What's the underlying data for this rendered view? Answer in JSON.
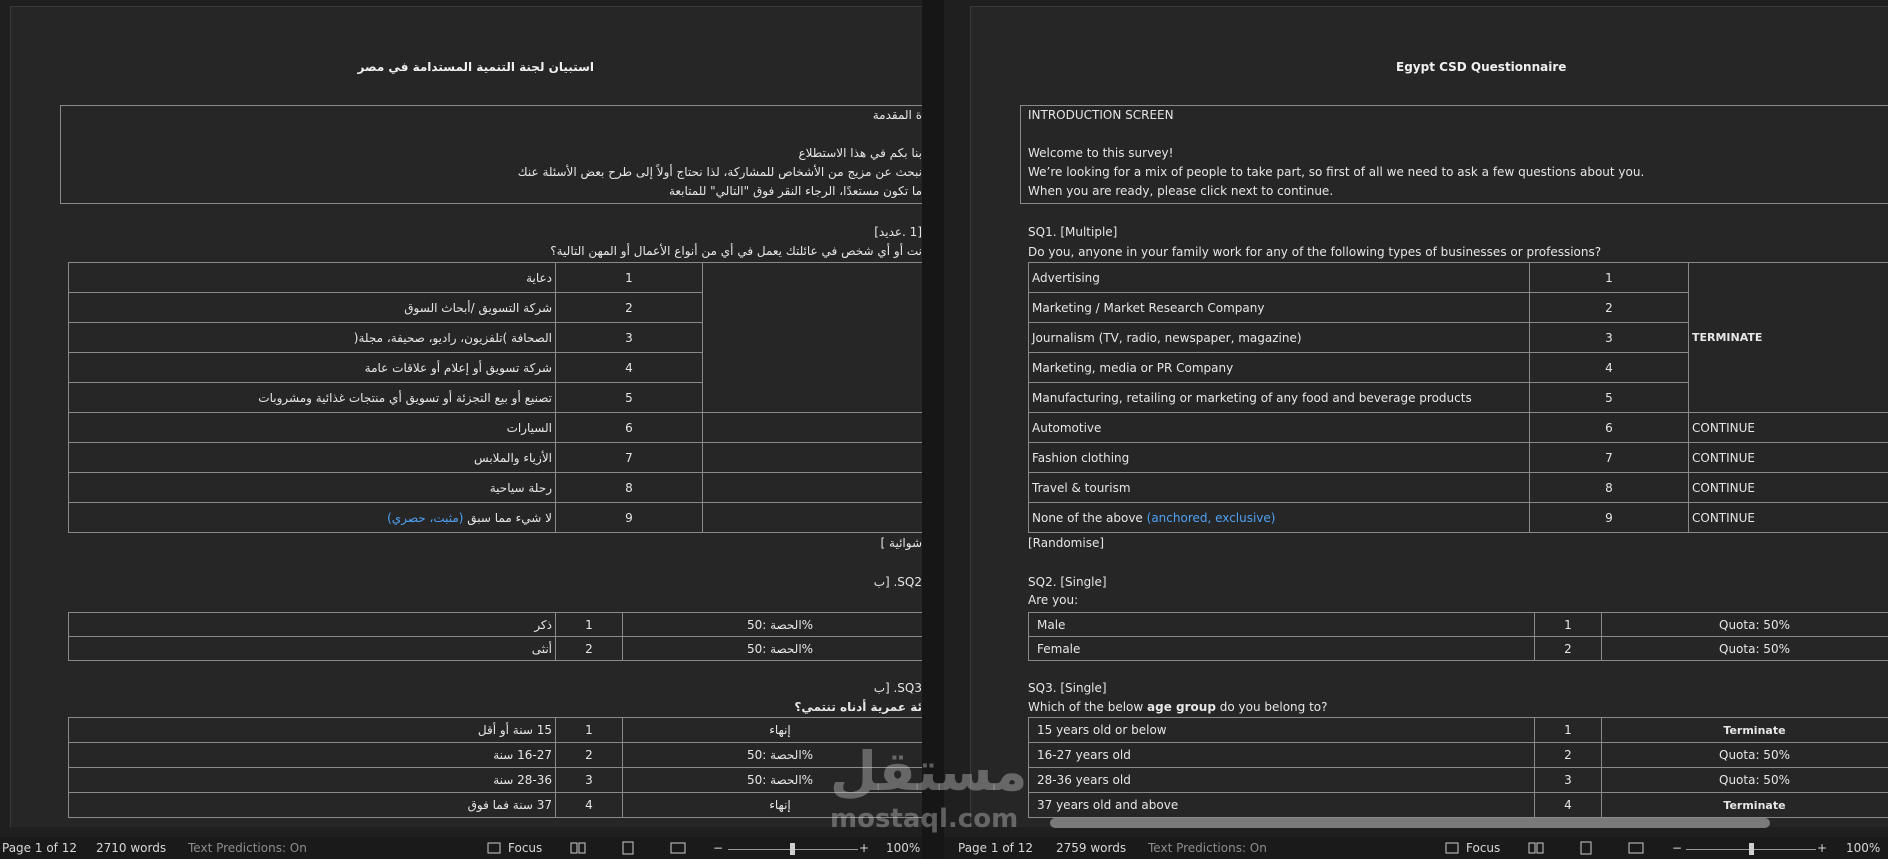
{
  "left": {
    "title": "استبيان لجنة التنمية المستدامة في مصر",
    "intro_lines": [
      "ة المقدمة",
      "بنا بكم في هذا الاستطلاع",
      "نبحث عن مزيج من الأشخاص للمشاركة، لذا نحتاج أولاً إلى طرح بعض الأسئلة عنك",
      "ما تكون مستعدًا، الرجاء النقر فوق \"التالي\" للمتابعة"
    ],
    "sq1_head": "[1 .عديد]",
    "sq1_question": "نت أو أي شخص في عائلتك يعمل في أي من أنواع الأعمال أو المهن التالية؟",
    "sq1_rows": [
      {
        "label": "دعاية",
        "code": "1"
      },
      {
        "label": "شركة التسويق  /أبحاث السوق",
        "code": "2"
      },
      {
        "label": "الصحافة )تلفزيون، راديو، صحيفة، مجلة(",
        "code": "3"
      },
      {
        "label": "شركة تسويق أو إعلام أو علاقات عامة",
        "code": "4"
      },
      {
        "label": "تصنيع أو بيع التجزئة أو تسويق أي منتجات غذائية ومشروبات",
        "code": "5"
      },
      {
        "label": "السيارات",
        "code": "6"
      },
      {
        "label": "الأزياء والملابس",
        "code": "7"
      },
      {
        "label": "رحلة سياحية",
        "code": "8"
      },
      {
        "label": "لا شيء مما سبق",
        "code": "9",
        "note": "(مثبت، حصري)"
      }
    ],
    "randomise": "شوائية ]",
    "sq2_head": "SQ2. [ب",
    "sq2_rows": [
      {
        "label": "ذكر",
        "code": "1",
        "quota": "50: الحصة%"
      },
      {
        "label": "أنثى",
        "code": "2",
        "quota": "50: الحصة%"
      }
    ],
    "sq3_head": "SQ3. [ب",
    "sq3_question": "ئة عمرية أدناه تنتمي؟",
    "sq3_rows": [
      {
        "label": "15 سنة أو أقل",
        "code": "1",
        "outcome": "إنهاء",
        "type": "red"
      },
      {
        "label": "16-27 سنة",
        "code": "2",
        "outcome": "50: الحصة%",
        "type": "blue"
      },
      {
        "label": "28-36 سنة",
        "code": "3",
        "outcome": "50: الحصة%",
        "type": "blue"
      },
      {
        "label": "37 سنة فما فوق",
        "code": "4",
        "outcome": "إنهاء",
        "type": "red"
      }
    ],
    "status": {
      "page": "Page 1 of 12",
      "words": "2710 words",
      "predictions": "Text Predictions: On",
      "focus": "Focus",
      "zoom": "100%"
    }
  },
  "right": {
    "title": "Egypt CSD Questionnaire",
    "intro_title": "INTRODUCTION SCREEN",
    "intro_lines": [
      "Welcome to this survey!",
      "We’re looking for a mix of people to take part, so first of all we need to ask a few questions about you.",
      "When you are ready, please click next to continue."
    ],
    "sq1_head": "SQ1. [Multiple]",
    "sq1_question": "Do you, anyone in your family work for any of the following types of businesses or professions?",
    "sq1_rows": [
      {
        "label": "Advertising",
        "code": "1"
      },
      {
        "label": "Marketing / Market Research Company",
        "code": "2"
      },
      {
        "label": "Journalism (TV, radio, newspaper, magazine)",
        "code": "3"
      },
      {
        "label": "Marketing, media or PR Company",
        "code": "4"
      },
      {
        "label": "Manufacturing, retailing or marketing of any food and beverage products",
        "code": "5"
      },
      {
        "label": "Automotive",
        "code": "6",
        "outcome": "CONTINUE"
      },
      {
        "label": "Fashion clothing",
        "code": "7",
        "outcome": "CONTINUE"
      },
      {
        "label": "Travel & tourism",
        "code": "8",
        "outcome": "CONTINUE"
      },
      {
        "label": "None of the above",
        "note": "(anchored, exclusive)",
        "code": "9",
        "outcome": "CONTINUE"
      }
    ],
    "terminate_merged": "TERMINATE",
    "randomise": "[Randomise]",
    "sq2_head": "SQ2. [Single]",
    "sq2_question": "Are you:",
    "sq2_rows": [
      {
        "label": "Male",
        "code": "1",
        "quota": "Quota: 50%"
      },
      {
        "label": "Female",
        "code": "2",
        "quota": "Quota: 50%"
      }
    ],
    "sq3_head": "SQ3. [Single]",
    "sq3_question_pre": "Which of the below ",
    "sq3_question_bold": "age group",
    "sq3_question_post": " do you belong to?",
    "sq3_rows": [
      {
        "label": "15 years old or below",
        "code": "1",
        "outcome": "Terminate",
        "type": "red"
      },
      {
        "label": "16-27 years old",
        "code": "2",
        "outcome": "Quota: 50%",
        "type": "blue"
      },
      {
        "label": "28-36 years old",
        "code": "3",
        "outcome": "Quota: 50%",
        "type": "blue"
      },
      {
        "label": "37 years old and above",
        "code": "4",
        "outcome": "Terminate",
        "type": "red"
      }
    ],
    "status": {
      "page": "Page 1 of 12",
      "words": "2759 words",
      "predictions": "Text Predictions: On",
      "focus": "Focus",
      "zoom": "100%"
    }
  },
  "watermark": {
    "arabic": "مستقل",
    "latin": "mostaql.com"
  },
  "colors": {
    "blue": "#4ea1f3",
    "red": "#e84a4a",
    "page_bg": "#262626"
  }
}
